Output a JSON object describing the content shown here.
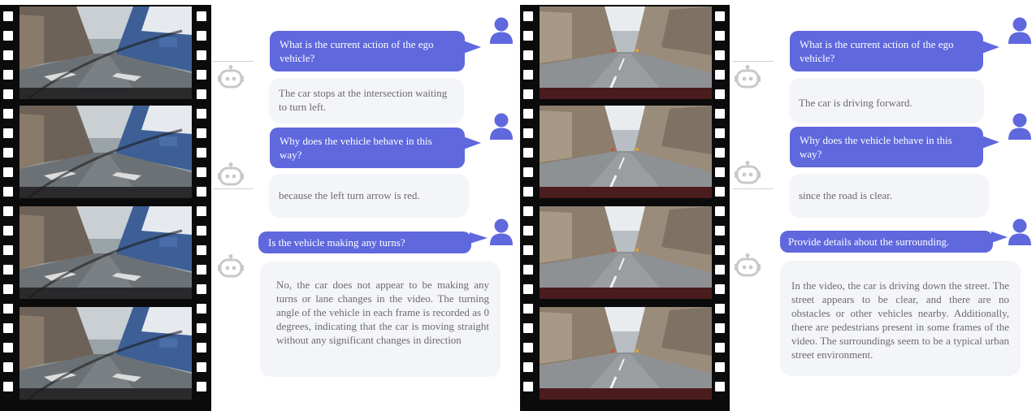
{
  "colors": {
    "user_bubble": "#5f68dd",
    "bot_bubble": "#f4f5f9",
    "user_icon": "#5f68dd",
    "bot_icon": "#c9c9c9",
    "film": "#0b0b0b"
  },
  "panels": [
    {
      "frames": [
        "rainy-street-frame-1",
        "rainy-street-frame-2",
        "rainy-street-frame-3",
        "rainy-street-frame-4"
      ],
      "dialogue": [
        {
          "role": "user",
          "text": "What is the current action of the ego vehicle?"
        },
        {
          "role": "bot",
          "text": "The car stops at the intersection waiting to turn left."
        },
        {
          "role": "user",
          "text": "Why does the vehicle behave in  this way?"
        },
        {
          "role": "bot",
          "text": "because the left turn arrow is red."
        },
        {
          "role": "user",
          "text": "Is the vehicle making any turns?"
        },
        {
          "role": "bot",
          "text": "No, the car does not appear to be making any turns or lane changes in the video. The turning angle of the vehicle in each frame is recorded as 0 degrees, indicating that the car is moving straight without any significant changes in direction"
        }
      ]
    },
    {
      "frames": [
        "clear-street-frame-1",
        "clear-street-frame-2",
        "clear-street-frame-3",
        "clear-street-frame-4"
      ],
      "dialogue": [
        {
          "role": "user",
          "text": "What is the current action of the ego vehicle?"
        },
        {
          "role": "bot",
          "text": "The car is driving forward."
        },
        {
          "role": "user",
          "text": "Why does the vehicle behave in  this way?"
        },
        {
          "role": "bot",
          "text": "since the road is clear."
        },
        {
          "role": "user",
          "text": "Provide details about the surrounding."
        },
        {
          "role": "bot",
          "text": "In the video, the car is driving down the street. The street appears to be clear, and there are no obstacles or other vehicles nearby. Additionally, there are pedestrians present in some frames of the video. The surroundings seem to be a typical urban street environment."
        }
      ]
    }
  ]
}
